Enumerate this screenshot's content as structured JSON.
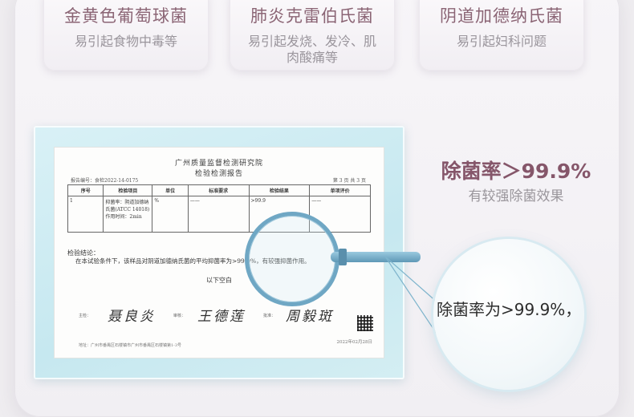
{
  "cards": [
    {
      "title": "金黄色葡萄球菌",
      "desc": "易引起食物中毒等"
    },
    {
      "title": "肺炎克雷伯氏菌",
      "desc": "易引起发烧、发冷、肌肉酸痛等"
    },
    {
      "title": "阴道加德纳氏菌",
      "desc": "易引起妇科问题"
    }
  ],
  "report": {
    "org": "广州质量监督检测研究院",
    "subtitle": "检验检测报告",
    "report_no": "报告编号：食检2022-14-0175",
    "page": "第 3 页 共 3 页",
    "columns": [
      "序号",
      "检验项目",
      "单位",
      "标准要求",
      "检验结果",
      "单项评价"
    ],
    "row": {
      "no": "1",
      "item": "抑菌率：阴道加德纳氏菌(ATCC 14018)作用时间：2min",
      "unit": "%",
      "standard": "——",
      "result": ">99.9",
      "judge": "——"
    },
    "conclusion_title": "检验结论：",
    "conclusion": "在本试验条件下，该样品对阴道加德纳氏菌的平均抑菌率为>99.9%，有较强抑菌作用。",
    "blank_note": "以下空白",
    "sign_labels": [
      "主检：",
      "审核：",
      "批准："
    ],
    "signatures": [
      "聂良炎",
      "王德莲",
      "周毅斑"
    ],
    "footer": "地址：广州市番禺区石楼镇市广州市番禺区石楼镇第1-3号",
    "date": "2022年02月28日"
  },
  "claim": {
    "headline": "除菌率＞99.9%",
    "sub": "有较强除菌效果"
  },
  "zoom": {
    "text": "除菌率为>99.9%，"
  },
  "colors": {
    "accent": "#85566a",
    "lens_frame": "#6fa7c4",
    "plate": "#c6e8f0"
  }
}
